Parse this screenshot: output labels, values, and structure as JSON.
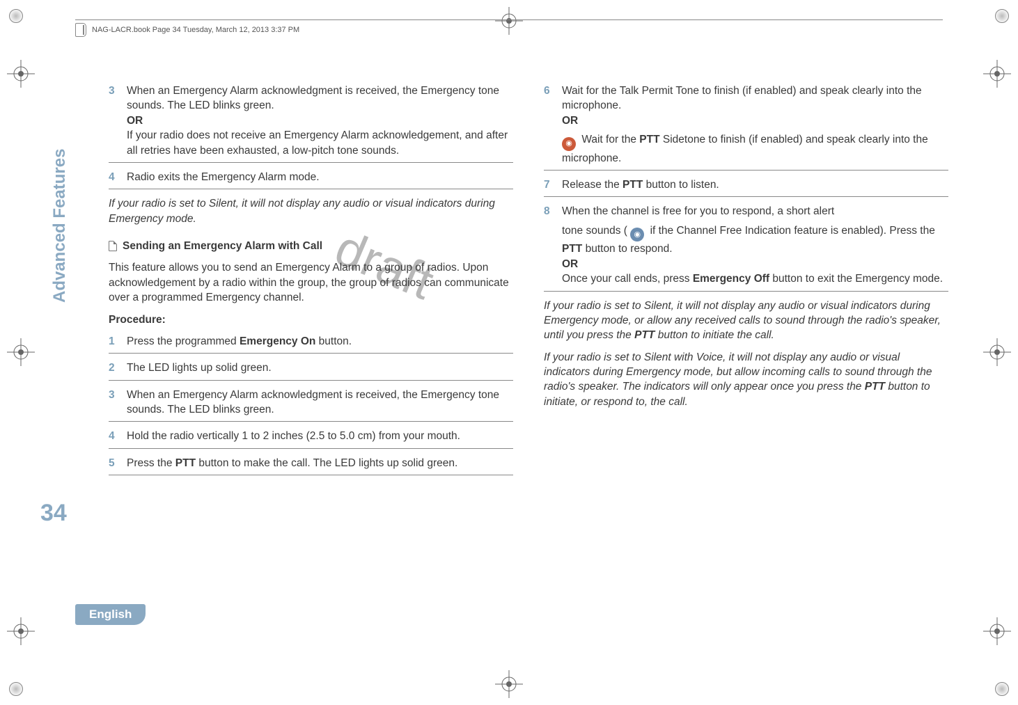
{
  "header": {
    "filename": "NAG-LACR.book  Page 34  Tuesday, March 12, 2013  3:37 PM"
  },
  "watermark": "draft",
  "side_tab": "Advanced Features",
  "page_number": "34",
  "language": "English",
  "left": {
    "step3": {
      "num": "3",
      "line1": "When an Emergency Alarm acknowledgment is received, the Emergency tone sounds. The LED blinks green.",
      "or": "OR",
      "line2": "If your radio does not receive an Emergency Alarm acknowledgement, and after all retries have been exhausted, a low-pitch tone sounds."
    },
    "step4": {
      "num": "4",
      "text": "Radio exits the Emergency Alarm mode."
    },
    "silent_note": "If your radio is set to Silent, it will not display any audio or visual indicators during Emergency mode.",
    "heading": "Sending an Emergency Alarm with Call",
    "intro": "This feature allows you to send an Emergency Alarm to a group of radios. Upon acknowledgement by a radio within the group, the group of radios can communicate over a programmed Emergency channel.",
    "procedure_label": "Procedure:",
    "p_step1": {
      "num": "1",
      "before": "Press the programmed ",
      "bold": "Emergency On",
      "after": " button."
    },
    "p_step2": {
      "num": "2",
      "text": "The LED lights up solid green."
    },
    "p_step3": {
      "num": "3",
      "text": "When an Emergency Alarm acknowledgment is received, the Emergency tone sounds. The LED blinks green."
    },
    "p_step4": {
      "num": "4",
      "text": "Hold the radio vertically 1 to 2 inches (2.5 to 5.0 cm) from your mouth."
    },
    "p_step5": {
      "num": "5",
      "before": "Press the ",
      "bold": "PTT",
      "after": " button to make the call. The LED lights up solid green."
    }
  },
  "right": {
    "step6": {
      "num": "6",
      "line1": "Wait for the Talk Permit Tone to finish (if enabled) and speak clearly into the microphone.",
      "or": "OR",
      "line2_before": " Wait for the ",
      "line2_bold": "PTT",
      "line2_after": " Sidetone to finish (if enabled) and speak clearly into the microphone."
    },
    "step7": {
      "num": "7",
      "before": "Release the ",
      "bold": "PTT",
      "after": " button to listen."
    },
    "step8": {
      "num": "8",
      "line1": "When the channel is free for you to respond, a short alert",
      "line2_before": "tone sounds (",
      "line2_mid": " if the Channel Free Indication feature is enabled). Press the ",
      "line2_bold": "PTT",
      "line2_after": " button to respond.",
      "or": "OR",
      "line3_before": "Once your call ends, press ",
      "line3_bold": "Emergency Off",
      "line3_after": " button to exit the Emergency mode."
    },
    "note1_before": "If your radio is set to Silent, it will not display any audio or visual indicators during Emergency mode, or allow any received calls to sound through the radio's speaker, until you press the ",
    "note1_bold": "PTT",
    "note1_after": " button to initiate the call.",
    "note2_before": "If your radio is set to Silent with Voice, it will not display any audio or visual indicators during Emergency mode, but allow incoming calls to sound through the radio's speaker. The indicators will only appear once you press the ",
    "note2_bold": "PTT",
    "note2_after": " button to initiate, or respond to, the call."
  }
}
